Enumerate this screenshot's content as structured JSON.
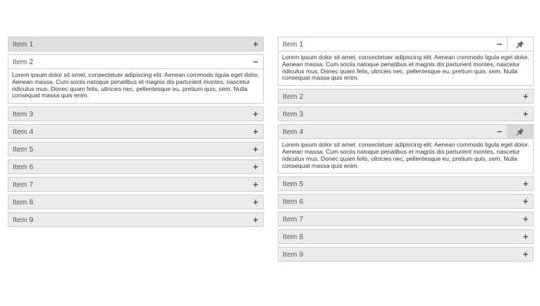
{
  "lorem": "Lorem ipsum dolor sit amet, consectetuer adipiscing elit. Aenean commodo ligula eget dolor. Aenean massa. Cum sociis natoque penatibus et magnis dis parturient montes, nascetur ridiculus mus. Donec quam felis, ultricies nec, pellentesque eu, pretium quis, sem. Nulla consequat massa quis enim.",
  "left_accordion": {
    "items": [
      {
        "label": "Item 1",
        "toggle": "+",
        "open": false
      },
      {
        "label": "Item 2",
        "toggle": "−",
        "open": true
      },
      {
        "label": "Item 3",
        "toggle": "+",
        "open": false
      },
      {
        "label": "Item 4",
        "toggle": "+",
        "open": false
      },
      {
        "label": "Item 5",
        "toggle": "+",
        "open": false
      },
      {
        "label": "Item 6",
        "toggle": "+",
        "open": false
      },
      {
        "label": "Item 7",
        "toggle": "+",
        "open": false
      },
      {
        "label": "Item 8",
        "toggle": "+",
        "open": false
      },
      {
        "label": "Item 9",
        "toggle": "+",
        "open": false
      }
    ]
  },
  "right_accordion": {
    "items": [
      {
        "label": "Item 1",
        "toggle": "−",
        "open": true
      },
      {
        "label": "Item 2",
        "toggle": "+",
        "open": false
      },
      {
        "label": "Item 3",
        "toggle": "+",
        "open": false
      },
      {
        "label": "Item 4",
        "toggle": "−",
        "open": true
      },
      {
        "label": "Item 5",
        "toggle": "+",
        "open": false
      },
      {
        "label": "Item 6",
        "toggle": "+",
        "open": false
      },
      {
        "label": "Item 7",
        "toggle": "+",
        "open": false
      },
      {
        "label": "Item 8",
        "toggle": "+",
        "open": false
      },
      {
        "label": "Item 9",
        "toggle": "+",
        "open": false
      }
    ]
  },
  "icons": {
    "pin": "pin-icon",
    "plus": "plus-icon",
    "minus": "minus-icon"
  },
  "colors": {
    "header_bg": "#ebebeb",
    "header_hover": "#dedede",
    "border": "#cfcfcf",
    "pin_active": "#d8d8d8"
  }
}
